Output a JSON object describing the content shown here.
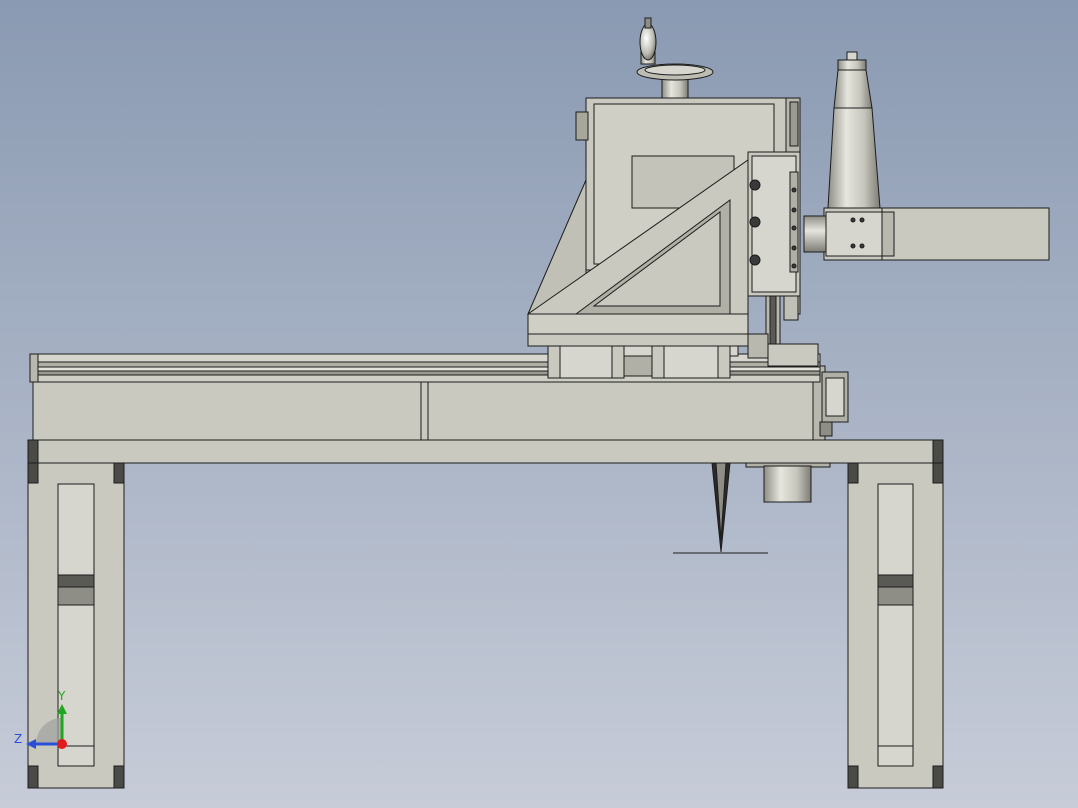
{
  "viewport": {
    "background_top": "#8a9ab2",
    "background_bottom": "#c7ccd8",
    "part_fill": "#c9c9c0",
    "part_fill_dark": "#a7a79c",
    "part_fill_light": "#e2e2da",
    "edge_color": "#1c1c1c",
    "shadow_color": "#3a3a3a"
  },
  "triad": {
    "y_label": "Y",
    "z_label": "Z",
    "y_color": "#1fa81f",
    "z_color": "#2a4fd6",
    "x_color": "#e21a1a"
  }
}
